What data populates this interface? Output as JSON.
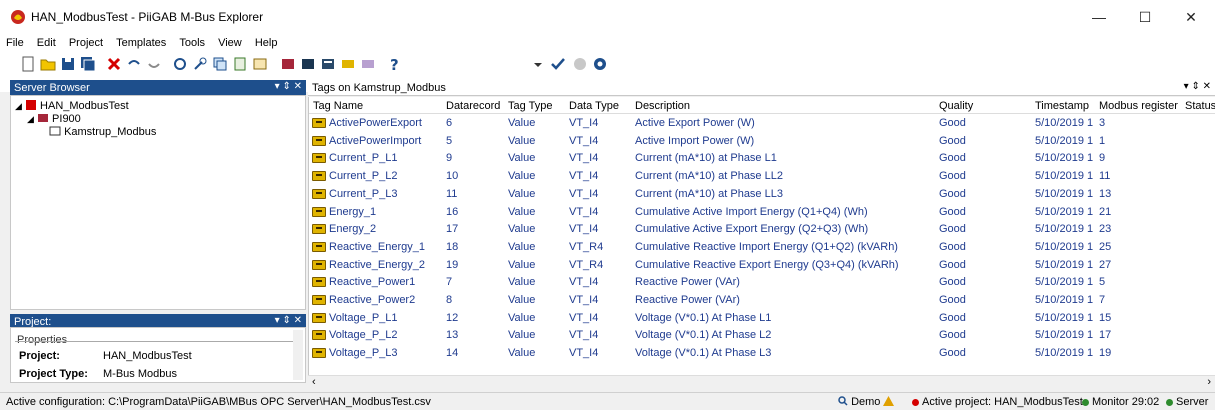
{
  "window": {
    "title": "HAN_ModbusTest - PiiGAB M-Bus Explorer"
  },
  "menu": {
    "items": [
      "File",
      "Edit",
      "Project",
      "Templates",
      "Tools",
      "View",
      "Help"
    ]
  },
  "server_browser": {
    "title": "Server Browser",
    "tree": [
      {
        "label": "HAN_ModbusTest",
        "level": 0
      },
      {
        "label": "PI900",
        "level": 1
      },
      {
        "label": "Kamstrup_Modbus",
        "level": 2
      }
    ]
  },
  "project_pane": {
    "title": "Project:",
    "group": "Properties",
    "rows": [
      {
        "label": "Project:",
        "value": "HAN_ModbusTest"
      },
      {
        "label": "Project Type:",
        "value": "M-Bus Modbus"
      }
    ]
  },
  "tags_pane": {
    "title": "Tags on Kamstrup_Modbus",
    "columns": [
      "Tag Name",
      "Datarecord",
      "Tag Type",
      "Data Type",
      "Description",
      "Quality",
      "Timestamp",
      "Modbus register",
      "Status"
    ],
    "rows": [
      [
        "ActivePowerExport",
        "6",
        "Value",
        "VT_I4",
        "Active Export Power (W)",
        "Good",
        "5/10/2019 1",
        "3"
      ],
      [
        "ActivePowerImport",
        "5",
        "Value",
        "VT_I4",
        "Active Import Power (W)",
        "Good",
        "5/10/2019 1",
        "1"
      ],
      [
        "Current_P_L1",
        "9",
        "Value",
        "VT_I4",
        "Current (mA*10) at Phase L1",
        "Good",
        "5/10/2019 1",
        "9"
      ],
      [
        "Current_P_L2",
        "10",
        "Value",
        "VT_I4",
        "Current (mA*10) at Phase LL2",
        "Good",
        "5/10/2019 1",
        "11"
      ],
      [
        "Current_P_L3",
        "11",
        "Value",
        "VT_I4",
        "Current (mA*10) at Phase LL3",
        "Good",
        "5/10/2019 1",
        "13"
      ],
      [
        "Energy_1",
        "16",
        "Value",
        "VT_I4",
        "Cumulative Active Import Energy (Q1+Q4) (Wh)",
        "Good",
        "5/10/2019 1",
        "21"
      ],
      [
        "Energy_2",
        "17",
        "Value",
        "VT_I4",
        "Cumulative Active Export Energy (Q2+Q3) (Wh)",
        "Good",
        "5/10/2019 1",
        "23"
      ],
      [
        "Reactive_Energy_1",
        "18",
        "Value",
        "VT_R4",
        "Cumulative Reactive Import Energy (Q1+Q2) (kVARh)",
        "Good",
        "5/10/2019 1",
        "25"
      ],
      [
        "Reactive_Energy_2",
        "19",
        "Value",
        "VT_R4",
        "Cumulative Reactive Export Energy (Q3+Q4) (kVARh)",
        "Good",
        "5/10/2019 1",
        "27"
      ],
      [
        "Reactive_Power1",
        "7",
        "Value",
        "VT_I4",
        "Reactive Power (VAr)",
        "Good",
        "5/10/2019 1",
        "5"
      ],
      [
        "Reactive_Power2",
        "8",
        "Value",
        "VT_I4",
        "Reactive Power (VAr)",
        "Good",
        "5/10/2019 1",
        "7"
      ],
      [
        "Voltage_P_L1",
        "12",
        "Value",
        "VT_I4",
        "Voltage (V*0.1) At Phase L1",
        "Good",
        "5/10/2019 1",
        "15"
      ],
      [
        "Voltage_P_L2",
        "13",
        "Value",
        "VT_I4",
        "Voltage (V*0.1) At Phase L2",
        "Good",
        "5/10/2019 1",
        "17"
      ],
      [
        "Voltage_P_L3",
        "14",
        "Value",
        "VT_I4",
        "Voltage (V*0.1) At Phase L3",
        "Good",
        "5/10/2019 1",
        "19"
      ]
    ]
  },
  "status": {
    "config": "Active configuration: C:\\ProgramData\\PiiGAB\\MBus OPC Server\\HAN_ModbusTest.csv",
    "demo": "Demo",
    "active_project": "Active project: HAN_ModbusTest",
    "monitor": "Monitor 29:02",
    "server": "Server"
  },
  "colors": {
    "header_blue": "#1e4f8c",
    "row_text": "#1f3b8f",
    "status_red": "#d40000",
    "status_green": "#2e8b2e"
  },
  "icons": [
    "app-icon",
    "new-icon",
    "open-icon",
    "save-icon",
    "save-all-icon",
    "delete-icon",
    "undo-icon",
    "redo-icon",
    "help-icon",
    "check-icon",
    "play-icon",
    "stop-icon",
    "tag-icon",
    "server-icon",
    "device-icon",
    "meter-icon",
    "warning-icon"
  ]
}
